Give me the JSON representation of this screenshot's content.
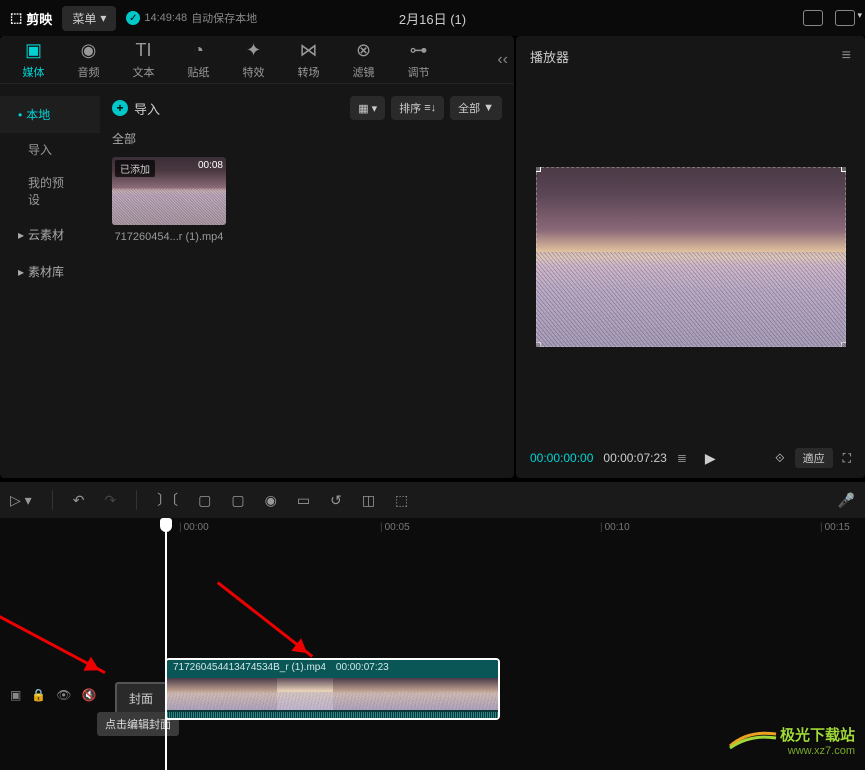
{
  "topbar": {
    "app_name": "剪映",
    "menu_label": "菜单",
    "autosave_time": "14:49:48",
    "autosave_text": "自动保存本地",
    "project_title": "2月16日 (1)"
  },
  "tabs": {
    "media": "媒体",
    "audio": "音频",
    "text": "文本",
    "sticker": "贴纸",
    "effect": "特效",
    "transition": "转场",
    "filter": "滤镜",
    "adjust": "调节"
  },
  "sidenav": {
    "local": "本地",
    "import": "导入",
    "preset": "我的预设",
    "cloud": "云素材",
    "library": "素材库"
  },
  "media_content": {
    "import_btn": "导入",
    "sort_label": "排序",
    "all_label": "全部",
    "all_title": "全部",
    "clip": {
      "added_badge": "已添加",
      "duration": "00:08",
      "filename": "717260454...r (1).mp4"
    }
  },
  "player": {
    "title": "播放器",
    "time_current": "00:00:00:00",
    "time_total": "00:00:07:23",
    "adapt_label": "適应"
  },
  "timeline": {
    "ticks": [
      {
        "pos": 0,
        "label": "00:00"
      },
      {
        "pos": 215,
        "label": "00:05"
      },
      {
        "pos": 435,
        "label": "00:10"
      },
      {
        "pos": 655,
        "label": "00:15"
      }
    ],
    "cover_btn": "封面",
    "tooltip": "点击编辑封面",
    "clip_filename": "717260454413474534B_r (1).mp4",
    "clip_duration": "00:00:07:23"
  },
  "watermark": {
    "main": "极光下载站",
    "sub": "www.xz7.com"
  }
}
